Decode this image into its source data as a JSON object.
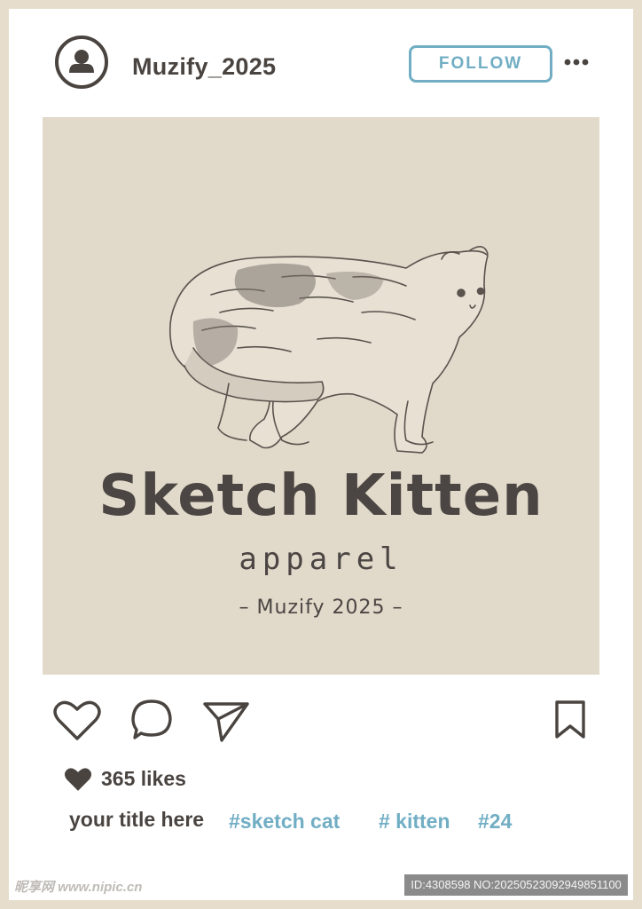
{
  "post": {
    "username": "Muzify_2025",
    "follow_label": "FOLLOW",
    "more_icon": "more-horizontal-icon",
    "image": {
      "title": "Sketch Kitten",
      "subtitle": "apparel",
      "tagline": "– Muzify 2025 –"
    },
    "actions": {
      "like_icon": "heart-icon",
      "comment_icon": "comment-icon",
      "share_icon": "send-icon",
      "save_icon": "bookmark-icon"
    },
    "likes_text": "365 likes",
    "caption": {
      "title": "your title here",
      "hashtags": [
        "#sketch cat",
        "# kitten",
        "#24"
      ]
    }
  },
  "watermark": {
    "left": "昵享网 www.nipic.cn",
    "right": "ID:4308598 NO:20250523092949851100"
  },
  "colors": {
    "frame": "#e6ddcc",
    "photo_bg": "#e1d9c9",
    "text_dark": "#4a4440",
    "accent": "#71aec4"
  }
}
